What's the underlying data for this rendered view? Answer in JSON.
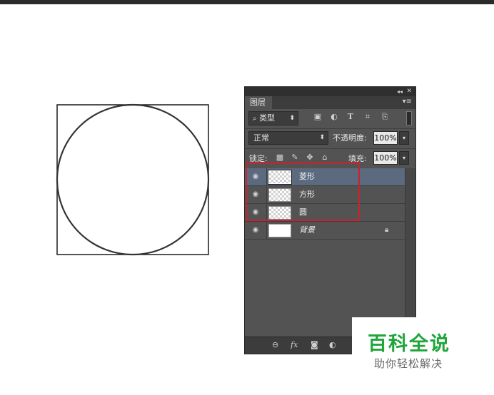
{
  "panel": {
    "tab_label": "图层",
    "filter": {
      "kind_label": "类型",
      "prefix_icon": "search-icon"
    },
    "blend_mode": "正常",
    "opacity_label": "不透明度:",
    "opacity_value": "100%",
    "lock_label": "锁定:",
    "fill_label": "填充:",
    "fill_value": "100%"
  },
  "layers": [
    {
      "name": "菱形",
      "selected": true,
      "thumb": "transparent"
    },
    {
      "name": "方形",
      "selected": false,
      "thumb": "transparent"
    },
    {
      "name": "圆",
      "selected": false,
      "thumb": "transparent"
    },
    {
      "name": "背景",
      "selected": false,
      "thumb": "white",
      "locked": true
    }
  ],
  "watermark": {
    "title": "百科全说",
    "subtitle": "助你轻松解决"
  },
  "colors": {
    "highlight_box": "#c8232c",
    "watermark_green": "#1fa53a",
    "selected_layer": "#5c6a80"
  }
}
